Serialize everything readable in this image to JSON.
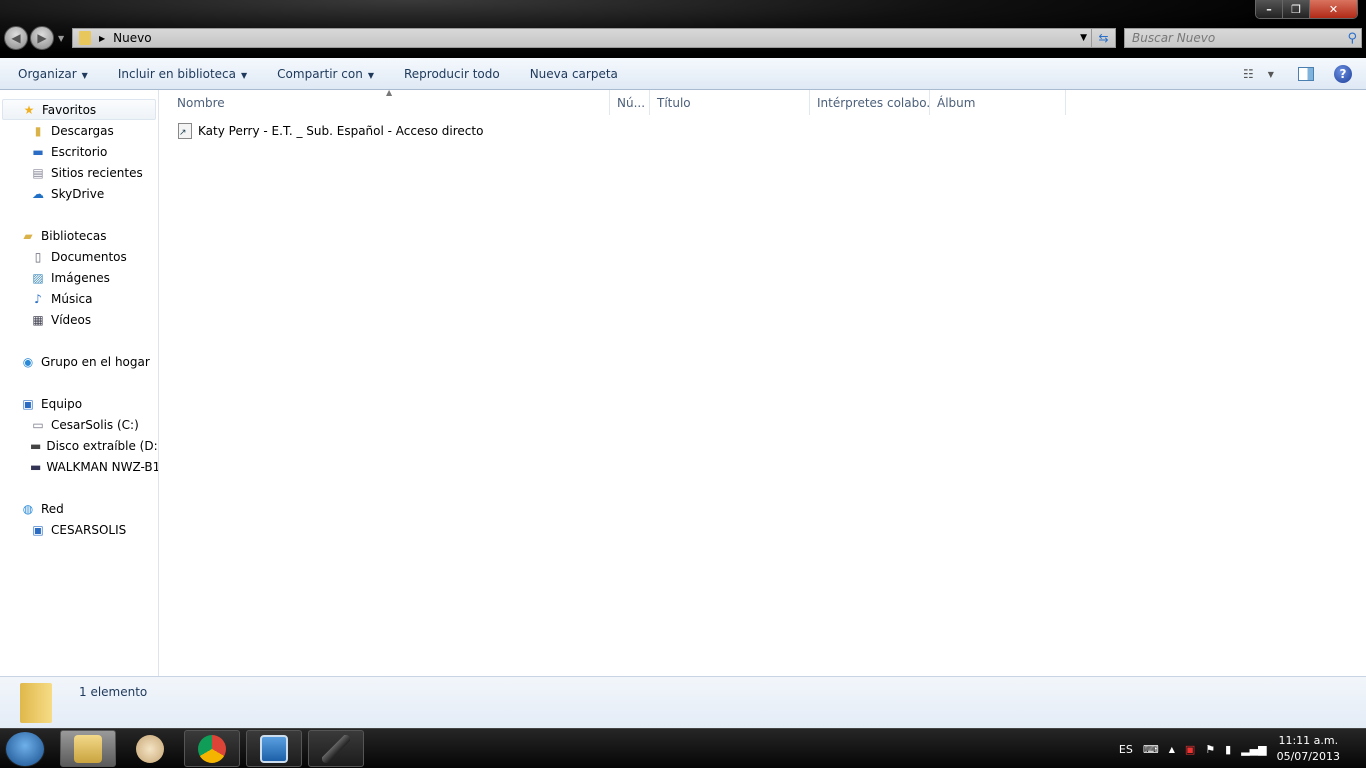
{
  "window": {
    "minimize": "–",
    "maximize": "❐",
    "close": "✕"
  },
  "address": {
    "path": "Nuevo",
    "search_placeholder": "Buscar Nuevo"
  },
  "toolbar": {
    "organize": "Organizar",
    "include": "Incluir en biblioteca",
    "share": "Compartir con",
    "play_all": "Reproducir todo",
    "new_folder": "Nueva carpeta",
    "help": "?"
  },
  "sidebar": {
    "groups": [
      {
        "label": "Favoritos",
        "icon": "star-icon",
        "items": [
          {
            "label": "Descargas",
            "icon": "downloads-icon"
          },
          {
            "label": "Escritorio",
            "icon": "desktop-icon"
          },
          {
            "label": "Sitios recientes",
            "icon": "recent-places-icon"
          },
          {
            "label": "SkyDrive",
            "icon": "skydrive-icon"
          }
        ]
      },
      {
        "label": "Bibliotecas",
        "icon": "libraries-icon",
        "items": [
          {
            "label": "Documentos",
            "icon": "documents-icon"
          },
          {
            "label": "Imágenes",
            "icon": "pictures-icon"
          },
          {
            "label": "Música",
            "icon": "music-icon"
          },
          {
            "label": "Vídeos",
            "icon": "videos-icon"
          }
        ]
      },
      {
        "label": "Grupo en el hogar",
        "icon": "homegroup-icon",
        "items": []
      },
      {
        "label": "Equipo",
        "icon": "computer-icon",
        "items": [
          {
            "label": "CesarSolis (C:)",
            "icon": "drive-c-icon"
          },
          {
            "label": "Disco extraíble (D:)",
            "icon": "removable-drive-icon"
          },
          {
            "label": "WALKMAN NWZ-B1",
            "icon": "walkman-icon"
          }
        ]
      },
      {
        "label": "Red",
        "icon": "network-icon",
        "items": [
          {
            "label": "CESARSOLIS",
            "icon": "network-computer-icon"
          }
        ]
      }
    ]
  },
  "columns": [
    "Nombre",
    "Nú...",
    "Título",
    "Intérpretes colabo...",
    "Álbum"
  ],
  "files": [
    {
      "name": "Katy Perry - E.T.  _ Sub. Español - Acceso directo"
    }
  ],
  "status": {
    "count": "1 elemento"
  },
  "taskbar": {
    "lang": "ES",
    "time": "11:11 a.m.",
    "date": "05/07/2013"
  }
}
